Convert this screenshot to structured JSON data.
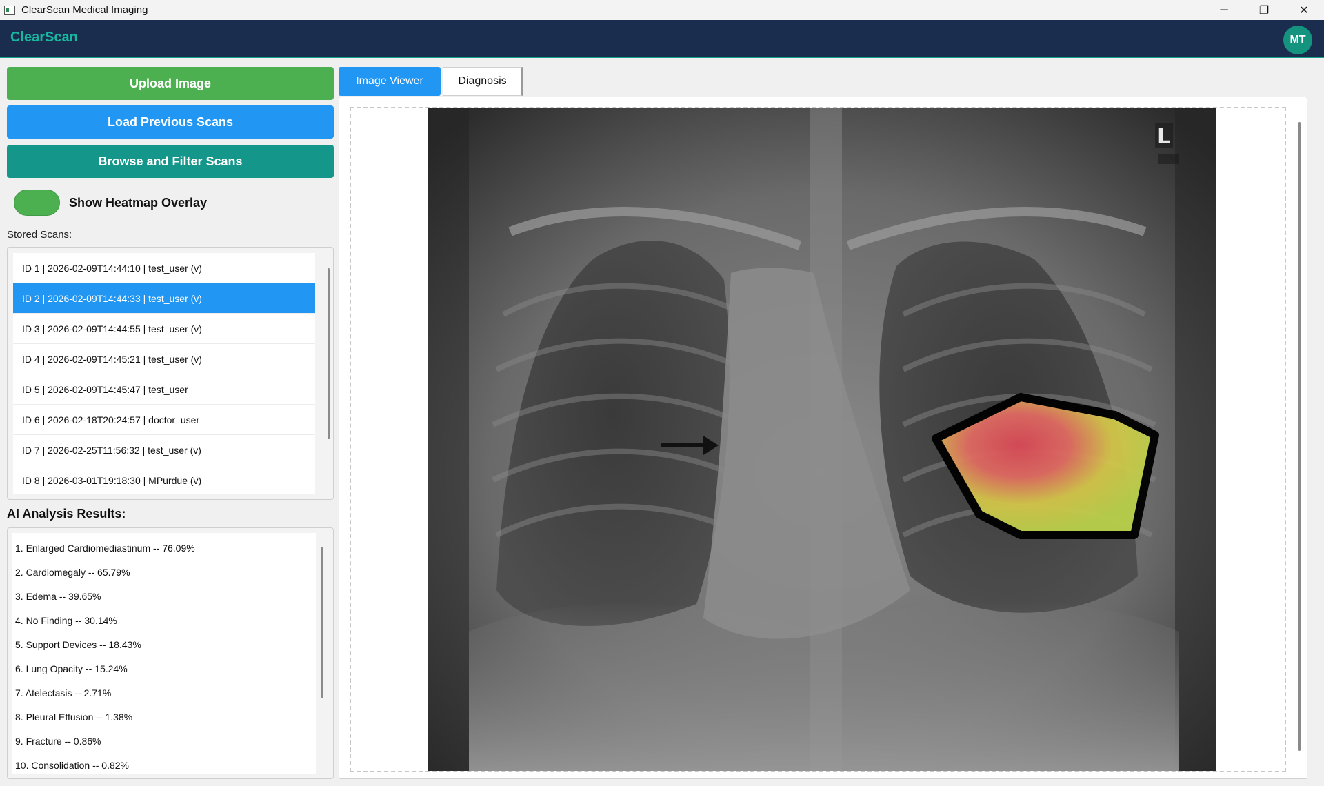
{
  "window": {
    "title": "ClearScan Medical Imaging",
    "minimize": "─",
    "restore": "❐",
    "close": "✕"
  },
  "header": {
    "brand": "ClearScan",
    "avatar_initials": "MT"
  },
  "actions": {
    "upload": "Upload Image",
    "load_previous": "Load Previous Scans",
    "browse_filter": "Browse and Filter Scans"
  },
  "heatmap_toggle": {
    "label": "Show Heatmap Overlay",
    "on": true
  },
  "stored_scans": {
    "label": "Stored Scans:",
    "selected_index": 1,
    "items": [
      "ID 1 | 2026-02-09T14:44:10 | test_user (v)",
      "ID 2 | 2026-02-09T14:44:33 | test_user (v)",
      "ID 3 | 2026-02-09T14:44:55 | test_user (v)",
      "ID 4 | 2026-02-09T14:45:21 | test_user (v)",
      "ID 5 | 2026-02-09T14:45:47 | test_user",
      "ID 6 | 2026-02-18T20:24:57 | doctor_user",
      "ID 7 | 2026-02-25T11:56:32 | test_user (v)",
      "ID 8 | 2026-03-01T19:18:30 | MPurdue (v)"
    ]
  },
  "ai_results": {
    "label": "AI Analysis Results:",
    "items": [
      "1. Enlarged Cardiomediastinum -- 76.09%",
      "2. Cardiomegaly -- 65.79%",
      "3. Edema -- 39.65%",
      "4. No Finding -- 30.14%",
      "5. Support Devices -- 18.43%",
      "6. Lung Opacity -- 15.24%",
      "7. Atelectasis -- 2.71%",
      "8. Pleural Effusion -- 1.38%",
      "9. Fracture -- 0.86%",
      "10. Consolidation -- 0.82%"
    ]
  },
  "tabs": {
    "viewer": "Image Viewer",
    "diagnosis": "Diagnosis",
    "active": "viewer"
  },
  "image": {
    "marker": "L"
  },
  "colors": {
    "accent": "#2196f3",
    "upload": "#4caf50",
    "browse": "#15968a",
    "header_bg": "#1b2d4f",
    "brand": "#17b8a0"
  }
}
